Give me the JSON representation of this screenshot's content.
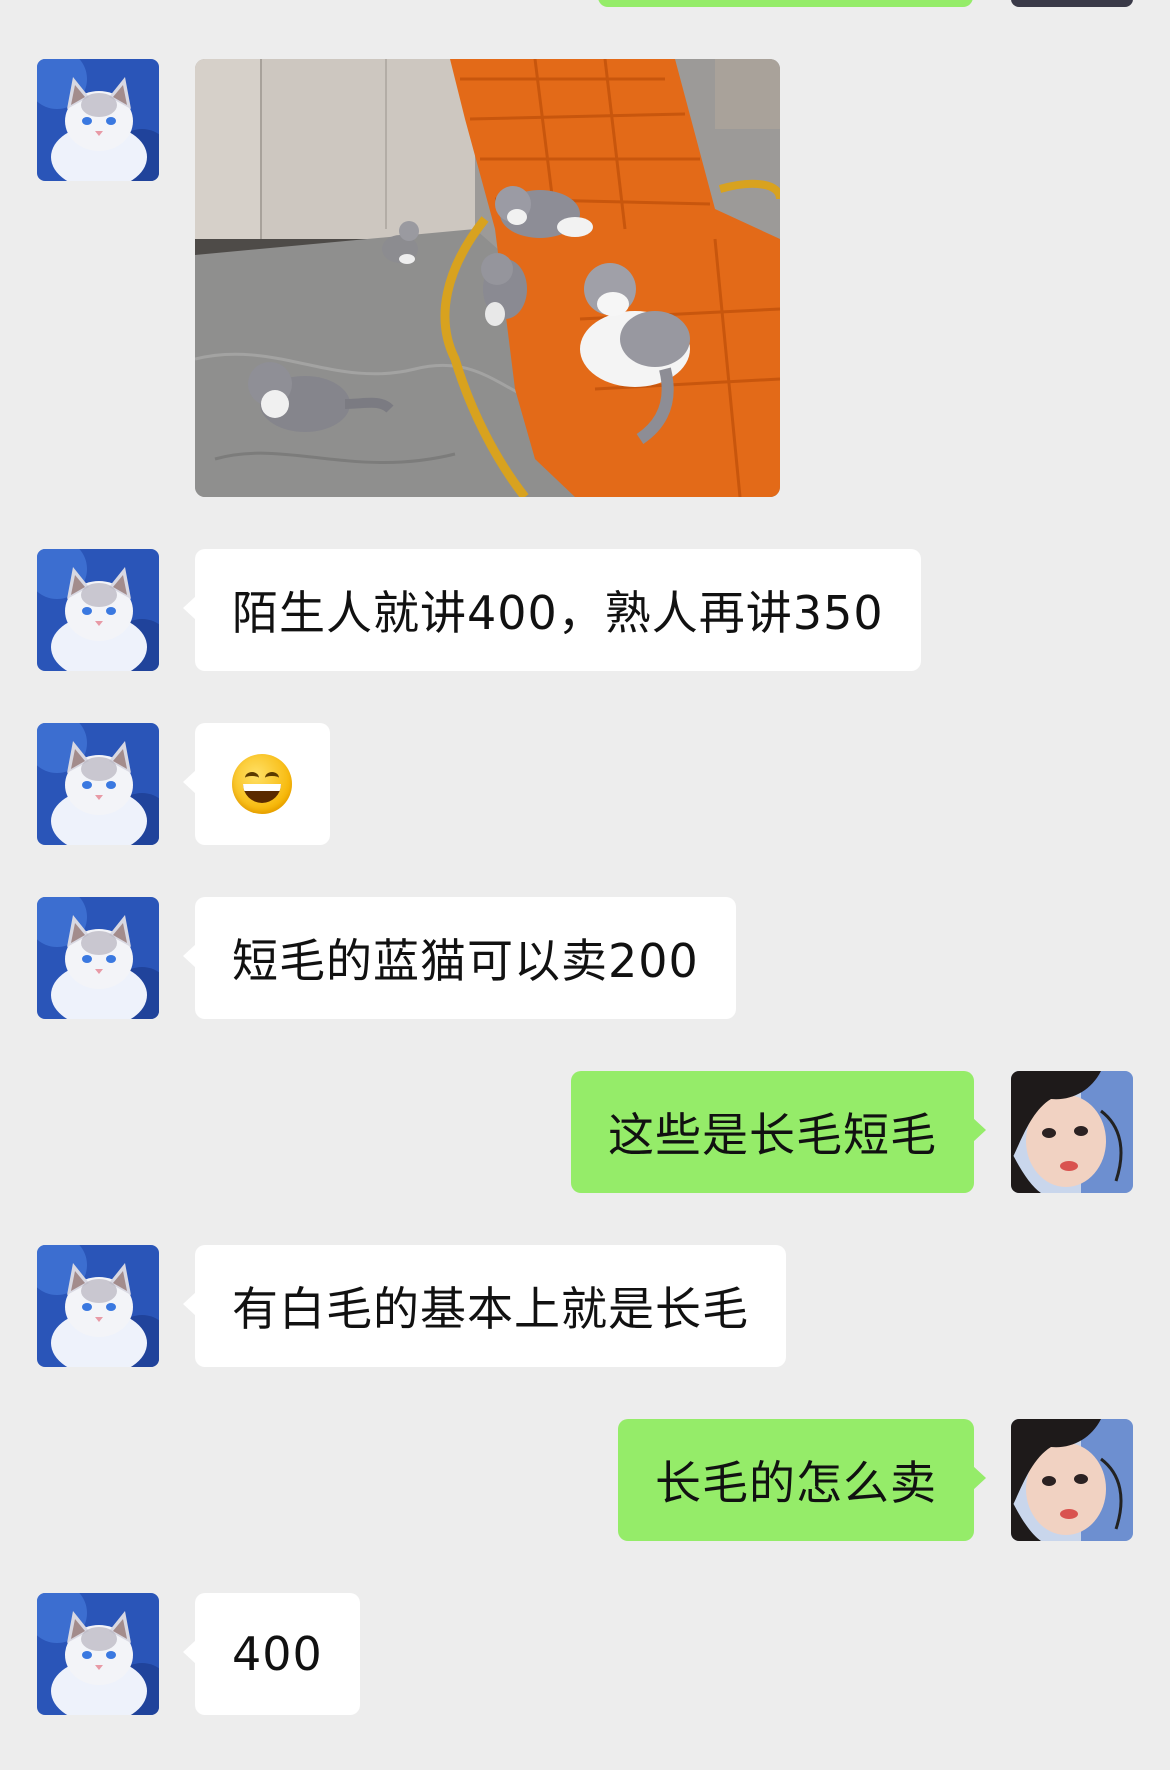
{
  "messages": [
    {
      "side": "left",
      "type": "image"
    },
    {
      "side": "left",
      "type": "text",
      "text": "陌生人就讲400，熟人再讲350"
    },
    {
      "side": "left",
      "type": "emoji",
      "emoji": "grinning-face"
    },
    {
      "side": "left",
      "type": "text",
      "text": "短毛的蓝猫可以卖200"
    },
    {
      "side": "right",
      "type": "text",
      "text": "这些是长毛短毛"
    },
    {
      "side": "left",
      "type": "text",
      "text": "有白毛的基本上就是长毛"
    },
    {
      "side": "right",
      "type": "text",
      "text": "长毛的怎么卖"
    },
    {
      "side": "left",
      "type": "text",
      "text": "400"
    }
  ],
  "colors": {
    "background": "#ededed",
    "sent_bubble": "#95ec69",
    "received_bubble": "#ffffff"
  },
  "icons": {
    "contact_avatar": "ragdoll-cat-avatar",
    "user_avatar": "user-selfie-avatar",
    "emoji": "grinning-face-emoji"
  }
}
